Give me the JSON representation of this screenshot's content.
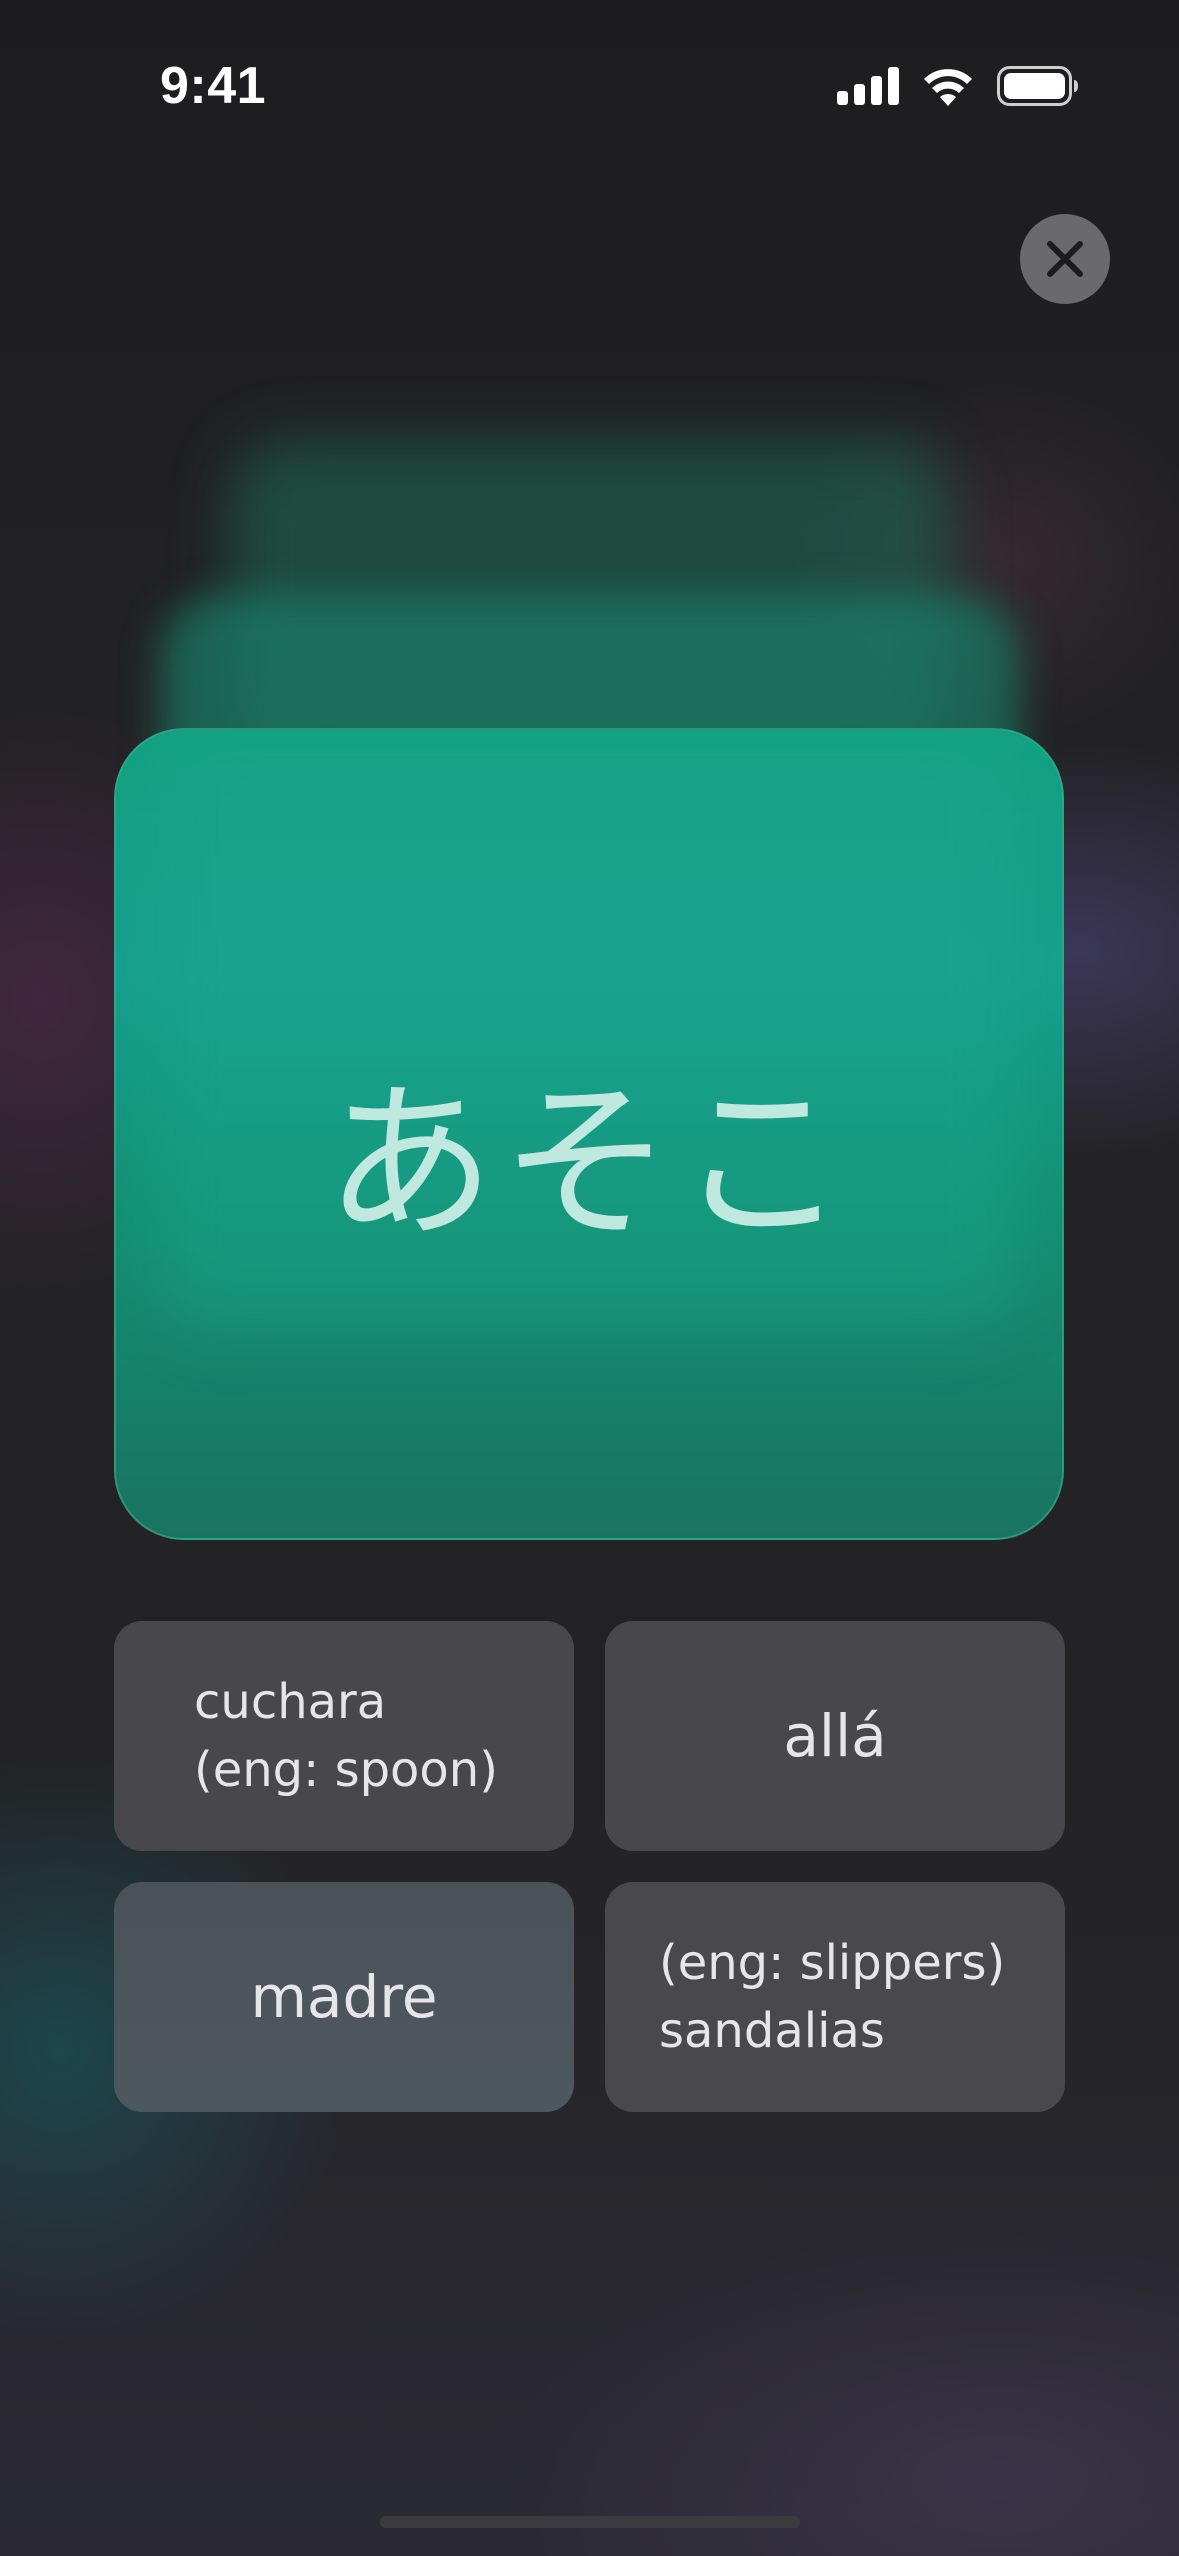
{
  "status_bar": {
    "time": "9:41",
    "icons": [
      "cellular-signal-icon",
      "wifi-icon",
      "battery-icon"
    ]
  },
  "controls": {
    "close_icon": "close-icon"
  },
  "flashcard": {
    "word": "あそこ",
    "color": "#12a080"
  },
  "options": [
    {
      "label": "cuchara\n(eng: spoon)"
    },
    {
      "label": "allá"
    },
    {
      "label": "madre"
    },
    {
      "label": "(eng: slippers)\nsandalias"
    }
  ],
  "colors": {
    "background": "#222224",
    "option_tile": "#48484c",
    "card_text": "#bfe8df"
  }
}
